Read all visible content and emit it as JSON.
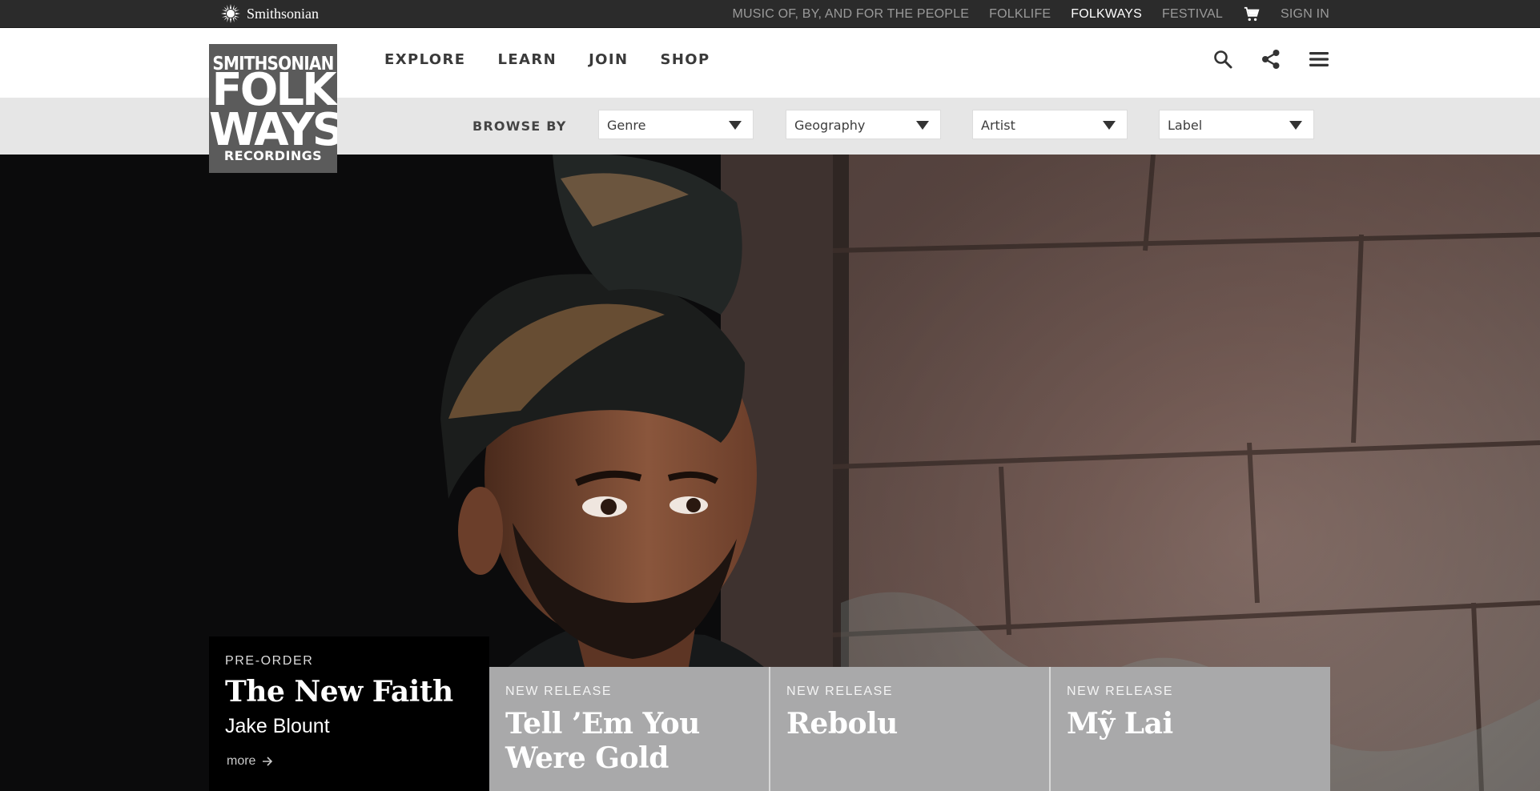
{
  "utility": {
    "brand": "Smithsonian",
    "links": [
      {
        "label": "MUSIC OF, BY, AND FOR THE PEOPLE"
      },
      {
        "label": "FOLKLIFE"
      },
      {
        "label": "FOLKWAYS"
      },
      {
        "label": "FESTIVAL"
      }
    ],
    "sign_in": "SIGN IN",
    "cart_icon": "cart-icon"
  },
  "logo": {
    "line1": "SMITHSONIAN",
    "line2": "FOLK",
    "line3": "WAYS",
    "line4": "RECORDINGS"
  },
  "nav": {
    "items": [
      {
        "label": "EXPLORE"
      },
      {
        "label": "LEARN"
      },
      {
        "label": "JOIN"
      },
      {
        "label": "SHOP"
      }
    ],
    "icons": [
      "search-icon",
      "share-icon",
      "menu-icon"
    ]
  },
  "browse": {
    "label": "BROWSE BY",
    "dropdowns": [
      {
        "label": "Genre"
      },
      {
        "label": "Geography"
      },
      {
        "label": "Artist"
      },
      {
        "label": "Label"
      }
    ]
  },
  "featured": {
    "kicker": "PRE-ORDER",
    "title": "The New Faith",
    "artist": "Jake Blount",
    "more": "more"
  },
  "releases": [
    {
      "kicker": "NEW RELEASE",
      "title": "Tell ’Em You Were Gold"
    },
    {
      "kicker": "NEW RELEASE",
      "title": "Rebolu"
    },
    {
      "kicker": "NEW RELEASE",
      "title": "Mỹ Lai"
    }
  ],
  "colors": {
    "utility_bar": "#2b2b2b",
    "browse_bar": "#e6e6e6",
    "card_grey": "#a9a9aa",
    "logo_box": "#5b5b5b"
  }
}
